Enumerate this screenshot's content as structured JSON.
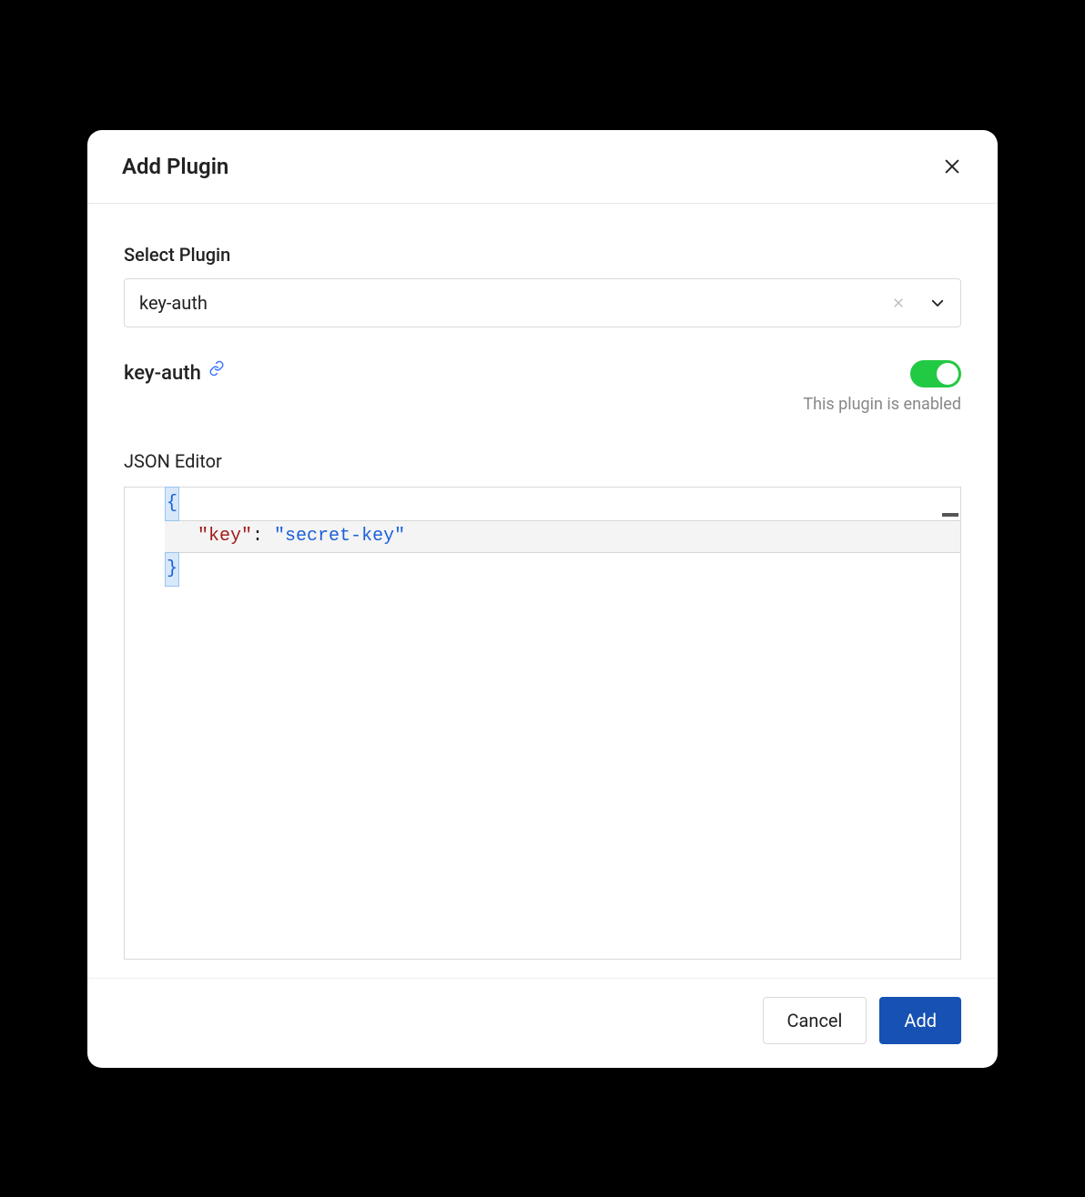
{
  "modal": {
    "title": "Add Plugin"
  },
  "form": {
    "select_label": "Select Plugin",
    "select_value": "key-auth",
    "plugin_name": "key-auth",
    "enabled_hint": "This plugin is enabled",
    "editor_label": "JSON Editor"
  },
  "editor": {
    "lines": [
      {
        "type": "brace",
        "text": "{"
      },
      {
        "type": "kv",
        "key": "\"key\"",
        "colon": ": ",
        "value": "\"secret-key\""
      },
      {
        "type": "brace",
        "text": "}"
      }
    ]
  },
  "footer": {
    "cancel": "Cancel",
    "submit": "Add"
  }
}
